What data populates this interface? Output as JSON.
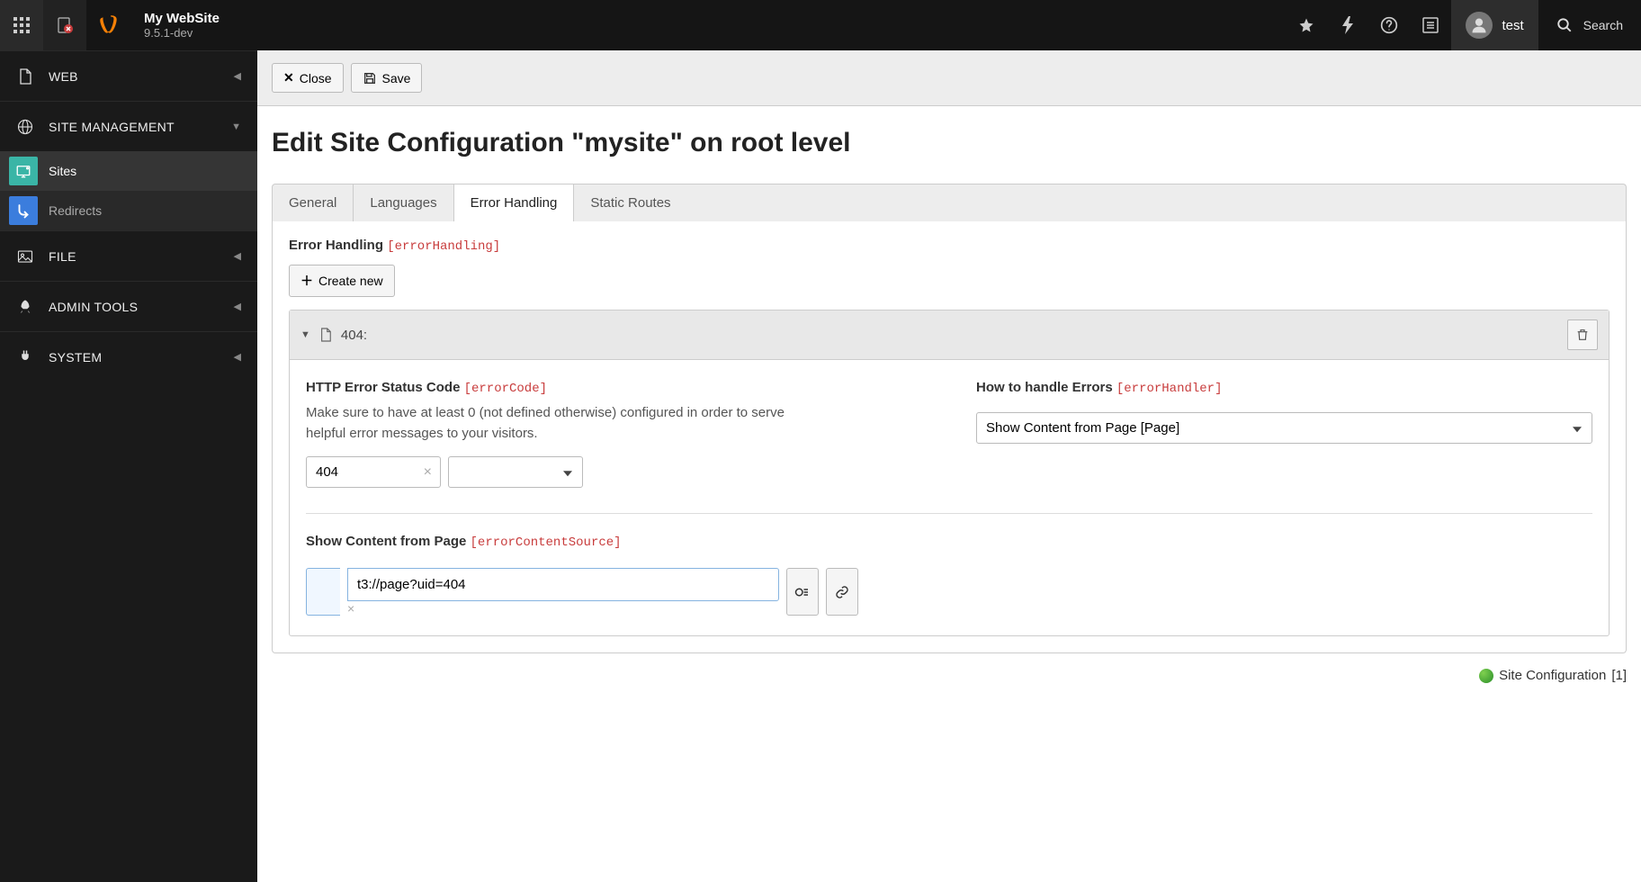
{
  "topbar": {
    "site_title": "My WebSite",
    "version": "9.5.1-dev",
    "user": "test",
    "search_label": "Search"
  },
  "sidebar": {
    "sections": [
      {
        "label": "WEB"
      },
      {
        "label": "SITE MANAGEMENT"
      },
      {
        "label": "FILE"
      },
      {
        "label": "ADMIN TOOLS"
      },
      {
        "label": "SYSTEM"
      }
    ],
    "site_mgmt_items": [
      {
        "label": "Sites"
      },
      {
        "label": "Redirects"
      }
    ]
  },
  "toolbar": {
    "close_label": "Close",
    "save_label": "Save"
  },
  "page": {
    "title": "Edit Site Configuration \"mysite\" on root level"
  },
  "tabs": [
    {
      "label": "General"
    },
    {
      "label": "Languages"
    },
    {
      "label": "Error Handling"
    },
    {
      "label": "Static Routes"
    }
  ],
  "section": {
    "title": "Error Handling",
    "tech": "[errorHandling]",
    "create_label": "Create new"
  },
  "record": {
    "title": "404:",
    "error_code": {
      "label": "HTTP Error Status Code",
      "tech": "[errorCode]",
      "help": "Make sure to have at least 0 (not defined otherwise) configured in order to serve helpful error messages to your visitors.",
      "value": "404"
    },
    "handler": {
      "label": "How to handle Errors",
      "tech": "[errorHandler]",
      "value": "Show Content from Page [Page]"
    },
    "content_source": {
      "label": "Show Content from Page",
      "tech": "[errorContentSource]",
      "value": "t3://page?uid=404"
    }
  },
  "footer": {
    "path_label": "Site Configuration",
    "path_id": "[1]"
  }
}
